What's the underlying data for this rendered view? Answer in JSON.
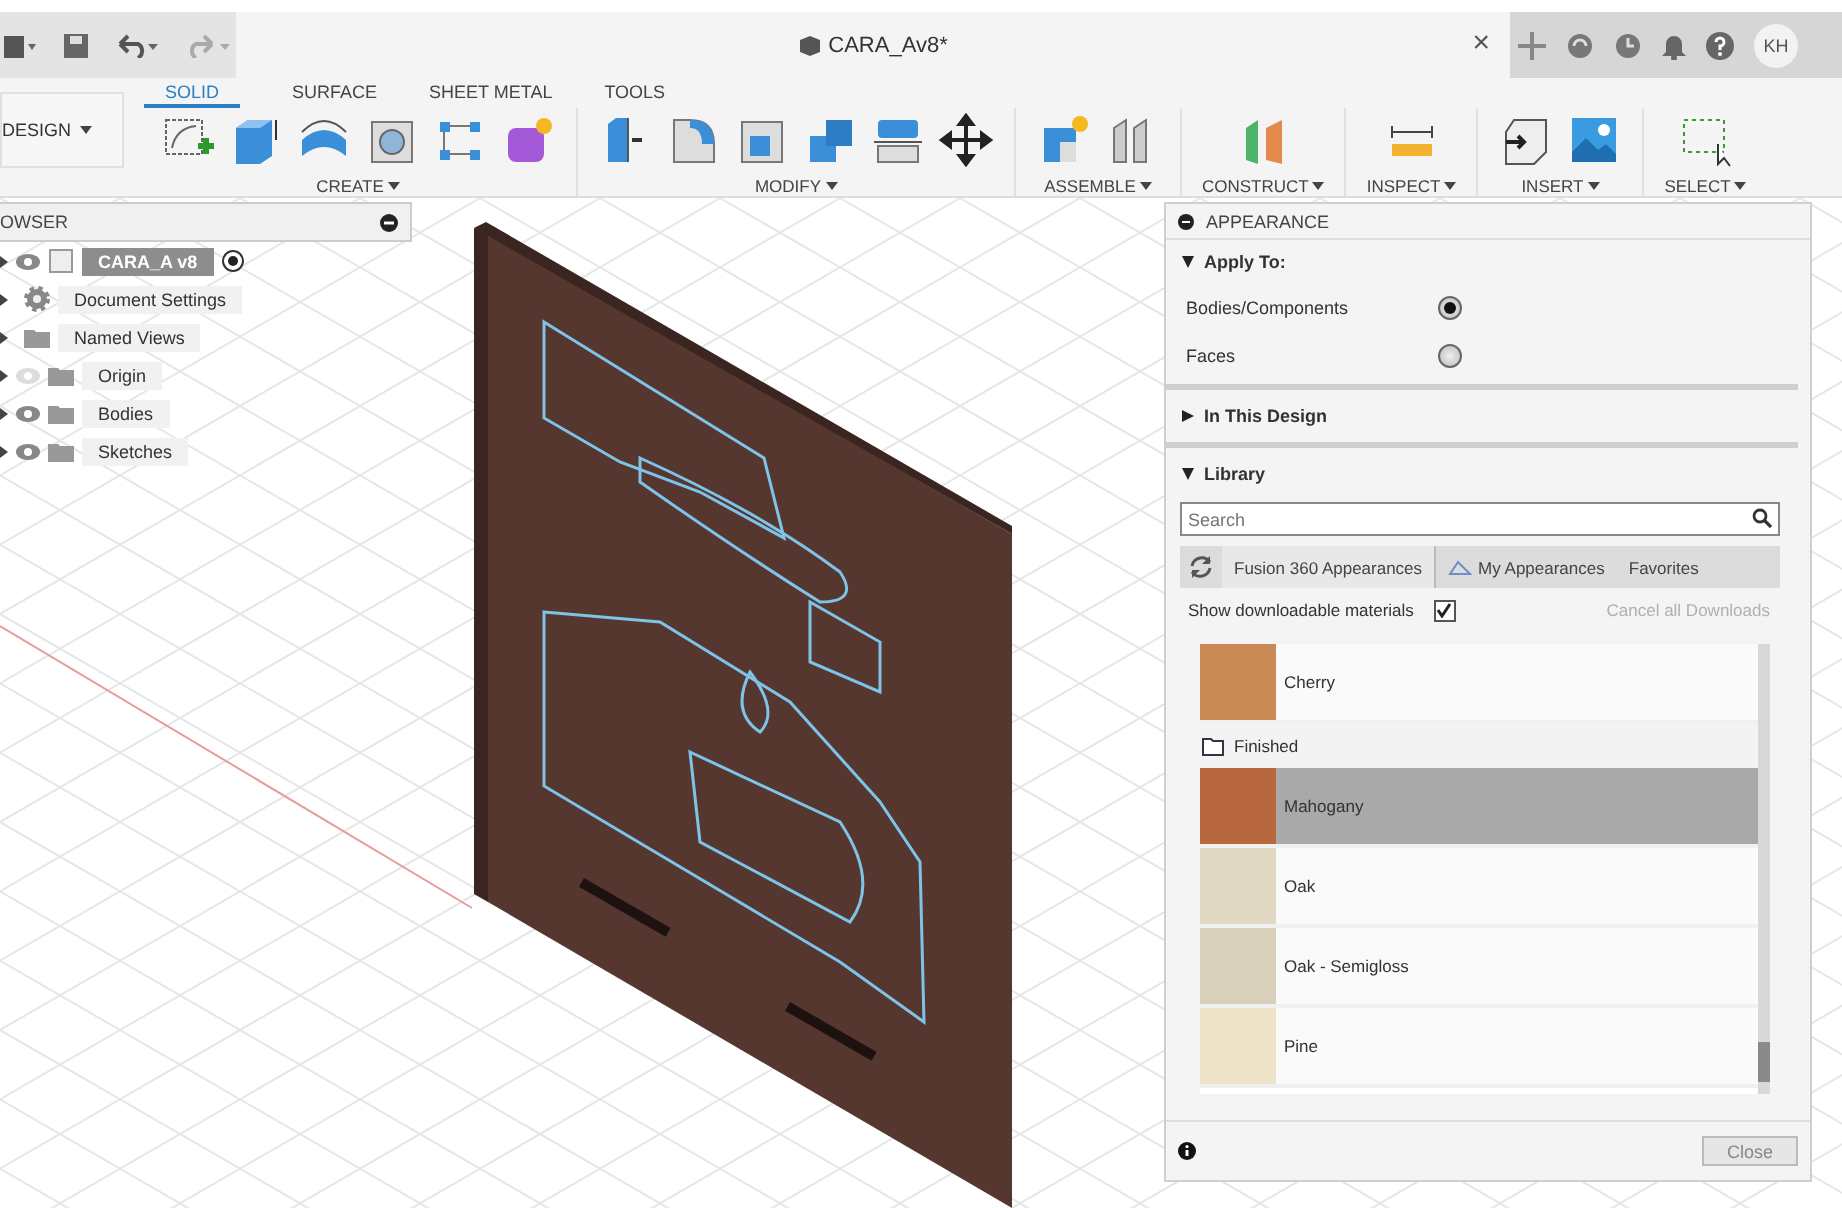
{
  "top_bar": {
    "document_title": "CARA_Av8*",
    "close": "×",
    "user_initials": "KH"
  },
  "toolbar": {
    "workspace": "DESIGN",
    "tabs": [
      {
        "label": "SOLID",
        "selected": true
      },
      {
        "label": "SURFACE",
        "selected": false
      },
      {
        "label": "SHEET METAL",
        "selected": false
      },
      {
        "label": "TOOLS",
        "selected": false
      }
    ],
    "groups": [
      {
        "label": "CREATE",
        "tools": [
          {
            "kind": "sketch"
          },
          {
            "kind": "extrude"
          },
          {
            "kind": "revolve"
          },
          {
            "kind": "hole"
          },
          {
            "kind": "pattern"
          },
          {
            "kind": "form"
          }
        ]
      },
      {
        "label": "MODIFY",
        "tools": [
          {
            "kind": "press-pull"
          },
          {
            "kind": "fillet"
          },
          {
            "kind": "shell"
          },
          {
            "kind": "combine"
          },
          {
            "kind": "split"
          },
          {
            "kind": "move"
          }
        ]
      },
      {
        "label": "ASSEMBLE",
        "tools": [
          {
            "kind": "component"
          },
          {
            "kind": "joint"
          }
        ]
      },
      {
        "label": "CONSTRUCT",
        "tools": [
          {
            "kind": "plane"
          }
        ]
      },
      {
        "label": "INSPECT",
        "tools": [
          {
            "kind": "measure"
          }
        ]
      },
      {
        "label": "INSERT",
        "tools": [
          {
            "kind": "insert"
          },
          {
            "kind": "image"
          }
        ]
      },
      {
        "label": "SELECT",
        "tools": [
          {
            "kind": "select"
          }
        ]
      }
    ]
  },
  "browser": {
    "title": "OWSER",
    "items": [
      {
        "label": "CARA_A v8",
        "kind": "component",
        "visible": true
      },
      {
        "label": "Document Settings",
        "kind": "settings"
      },
      {
        "label": "Named Views",
        "kind": "folder"
      },
      {
        "label": "Origin",
        "kind": "folder",
        "visible": false
      },
      {
        "label": "Bodies",
        "kind": "folder",
        "visible": true
      },
      {
        "label": "Sketches",
        "kind": "folder",
        "visible": true
      }
    ]
  },
  "appearance": {
    "title": "APPEARANCE",
    "apply_to": {
      "label": "Apply To:",
      "expanded": true,
      "options": [
        {
          "label": "Bodies/Components",
          "selected": true
        },
        {
          "label": "Faces",
          "selected": false
        }
      ]
    },
    "in_this_design": {
      "label": "In This Design",
      "expanded": false
    },
    "library": {
      "label": "Library",
      "expanded": true,
      "search": {
        "placeholder": "Search"
      },
      "tabs": [
        {
          "label": "Fusion 360 Appearances",
          "selected": true
        },
        {
          "label": "My Appearances",
          "selected": false
        },
        {
          "label": "Favorites",
          "selected": false
        }
      ],
      "show_downloadable": {
        "label": "Show downloadable materials",
        "checked": true
      },
      "cancel_downloads": {
        "label": "Cancel all Downloads",
        "disabled": true
      },
      "items": [
        {
          "kind": "material",
          "label": "Cherry",
          "color": "#c98a55",
          "selected": false
        },
        {
          "kind": "folder",
          "label": "Finished"
        },
        {
          "kind": "material",
          "label": "Mahogany",
          "color": "#b8683e",
          "selected": true
        },
        {
          "kind": "material",
          "label": "Oak",
          "color": "#e2d9c4",
          "selected": false
        },
        {
          "kind": "material",
          "label": "Oak - Semigloss",
          "color": "#d9d0bb",
          "selected": false
        },
        {
          "kind": "material",
          "label": "Pine",
          "color": "#ece3c8",
          "selected": false
        }
      ]
    },
    "close": "Close"
  }
}
